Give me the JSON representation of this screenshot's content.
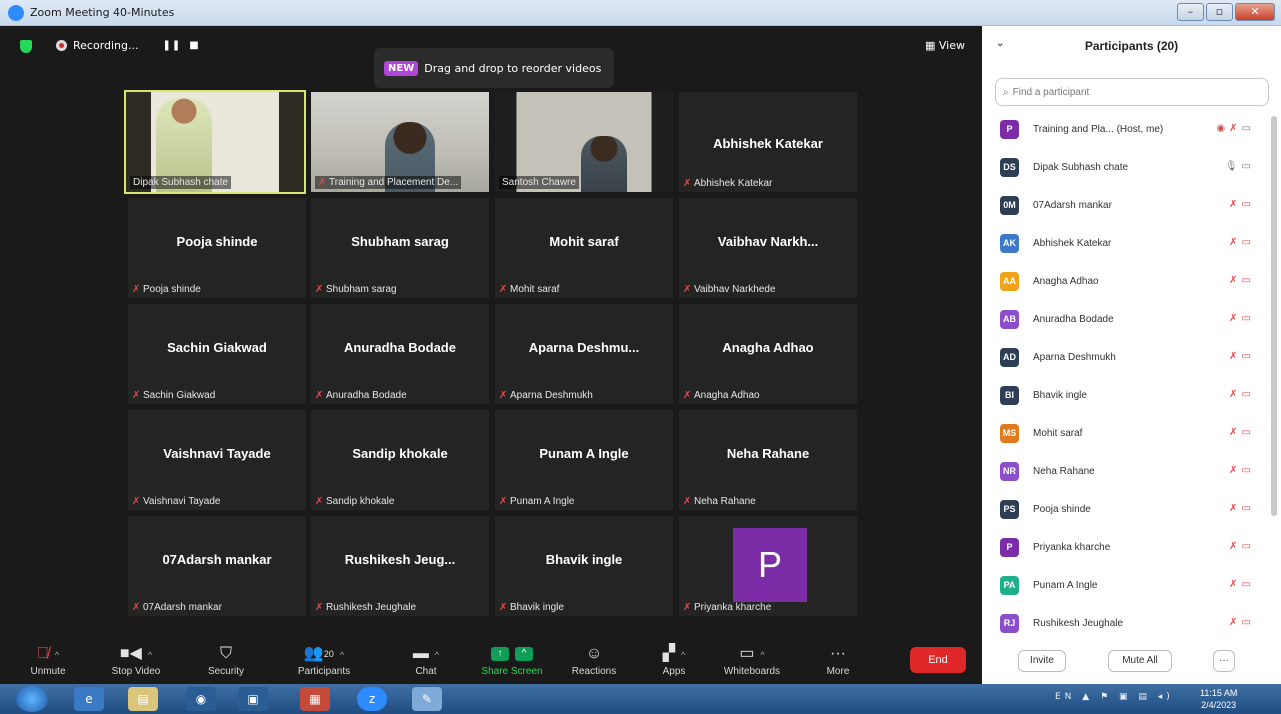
{
  "window": {
    "title": "Zoom Meeting 40-Minutes"
  },
  "top": {
    "recording": "Recording...",
    "view": "View",
    "toast_badge": "NEW",
    "toast_msg": "Drag and drop to reorder videos"
  },
  "tiles": [
    {
      "big": "",
      "label": "Dipak Subhash chate"
    },
    {
      "big": "",
      "label": "Training and Placement De..."
    },
    {
      "big": "",
      "label": "Santosh Chawre"
    },
    {
      "big": "Abhishek Katekar",
      "label": "Abhishek Katekar"
    },
    {
      "big": "Pooja shinde",
      "label": "Pooja shinde"
    },
    {
      "big": "Shubham sarag",
      "label": "Shubham sarag"
    },
    {
      "big": "Mohit saraf",
      "label": "Mohit saraf"
    },
    {
      "big": "Vaibhav  Narkh...",
      "label": "Vaibhav  Narkhede"
    },
    {
      "big": "Sachin Giakwad",
      "label": "Sachin Giakwad"
    },
    {
      "big": "Anuradha Bodade",
      "label": "Anuradha Bodade"
    },
    {
      "big": "Aparna Deshmu...",
      "label": "Aparna Deshmukh"
    },
    {
      "big": "Anagha Adhao",
      "label": "Anagha Adhao"
    },
    {
      "big": "Vaishnavi Tayade",
      "label": "Vaishnavi Tayade"
    },
    {
      "big": "Sandip khokale",
      "label": "Sandip khokale"
    },
    {
      "big": "Punam A Ingle",
      "label": "Punam A Ingle"
    },
    {
      "big": "Neha Rahane",
      "label": "Neha Rahane"
    },
    {
      "big": "07Adarsh mankar",
      "label": "07Adarsh mankar"
    },
    {
      "big": "Rushikesh  Jeug...",
      "label": "Rushikesh Jeughale"
    },
    {
      "big": "Bhavik ingle",
      "label": "Bhavik ingle"
    },
    {
      "big": "P",
      "label": "Priyanka kharche"
    }
  ],
  "toolbar": {
    "unmute": "Unmute",
    "stop_video": "Stop Video",
    "security": "Security",
    "participants": "Participants",
    "participants_count": "20",
    "chat": "Chat",
    "share": "Share Screen",
    "reactions": "Reactions",
    "apps": "Apps",
    "whiteboards": "Whiteboards",
    "more": "More",
    "end": "End"
  },
  "panel": {
    "title": "Participants (20)",
    "search_placeholder": "Find a participant",
    "invite": "Invite",
    "mute_all": "Mute All",
    "more": "···",
    "participants": [
      {
        "initials": "P",
        "name": "Training and Pla... (Host, me)",
        "color": "#7b2ca6"
      },
      {
        "initials": "DS",
        "name": "Dipak Subhash chate",
        "color": "#2d3e55"
      },
      {
        "initials": "0M",
        "name": "07Adarsh mankar",
        "color": "#2d3e55"
      },
      {
        "initials": "AK",
        "name": "Abhishek Katekar",
        "color": "#3d79c9"
      },
      {
        "initials": "AA",
        "name": "Anagha Adhao",
        "color": "#f0a21a"
      },
      {
        "initials": "AB",
        "name": "Anuradha Bodade",
        "color": "#8b4fc9"
      },
      {
        "initials": "AD",
        "name": "Aparna Deshmukh",
        "color": "#2d3e55"
      },
      {
        "initials": "BI",
        "name": "Bhavik ingle",
        "color": "#2d3e55"
      },
      {
        "initials": "MS",
        "name": "Mohit saraf",
        "color": "#e07a1f"
      },
      {
        "initials": "NR",
        "name": "Neha Rahane",
        "color": "#8b4fc9"
      },
      {
        "initials": "PS",
        "name": "Pooja shinde",
        "color": "#2d3e55"
      },
      {
        "initials": "P",
        "name": "Priyanka kharche",
        "color": "#7b2ca6"
      },
      {
        "initials": "PA",
        "name": "Punam A Ingle",
        "color": "#1faf8a"
      },
      {
        "initials": "RJ",
        "name": "Rushikesh Jeughale",
        "color": "#8b4fc9"
      }
    ]
  },
  "taskbar": {
    "lang": "EN",
    "time": "11:15 AM",
    "date": "2/4/2023"
  }
}
